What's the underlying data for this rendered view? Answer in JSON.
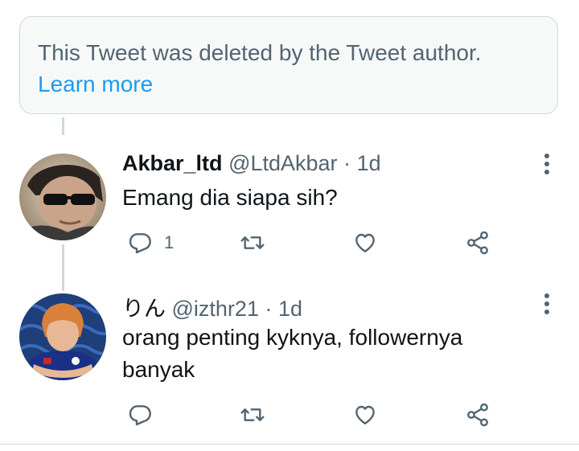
{
  "deleted_notice": {
    "text": "This Tweet was deleted by the Tweet author.",
    "link_label": "Learn more",
    "link_color": "#1d9bf0"
  },
  "tweets": [
    {
      "display_name": "Akbar_ltd",
      "handle": "@LtdAkbar",
      "separator": "·",
      "time": "1d",
      "text": "Emang dia siapa sih?",
      "reply_count": "1",
      "icons": [
        "reply-icon",
        "retweet-icon",
        "like-icon",
        "share-icon",
        "more-icon"
      ]
    },
    {
      "display_name": "りん",
      "handle": "@izthr21",
      "separator": "·",
      "time": "1d",
      "text": "orang penting kyknya, followernya banyak",
      "reply_count": "",
      "icons": [
        "reply-icon",
        "retweet-icon",
        "like-icon",
        "share-icon",
        "more-icon"
      ]
    }
  ],
  "colors": {
    "text_primary": "#0f1419",
    "text_secondary": "#536471",
    "border": "#cfd9de",
    "icon": "#536471"
  }
}
